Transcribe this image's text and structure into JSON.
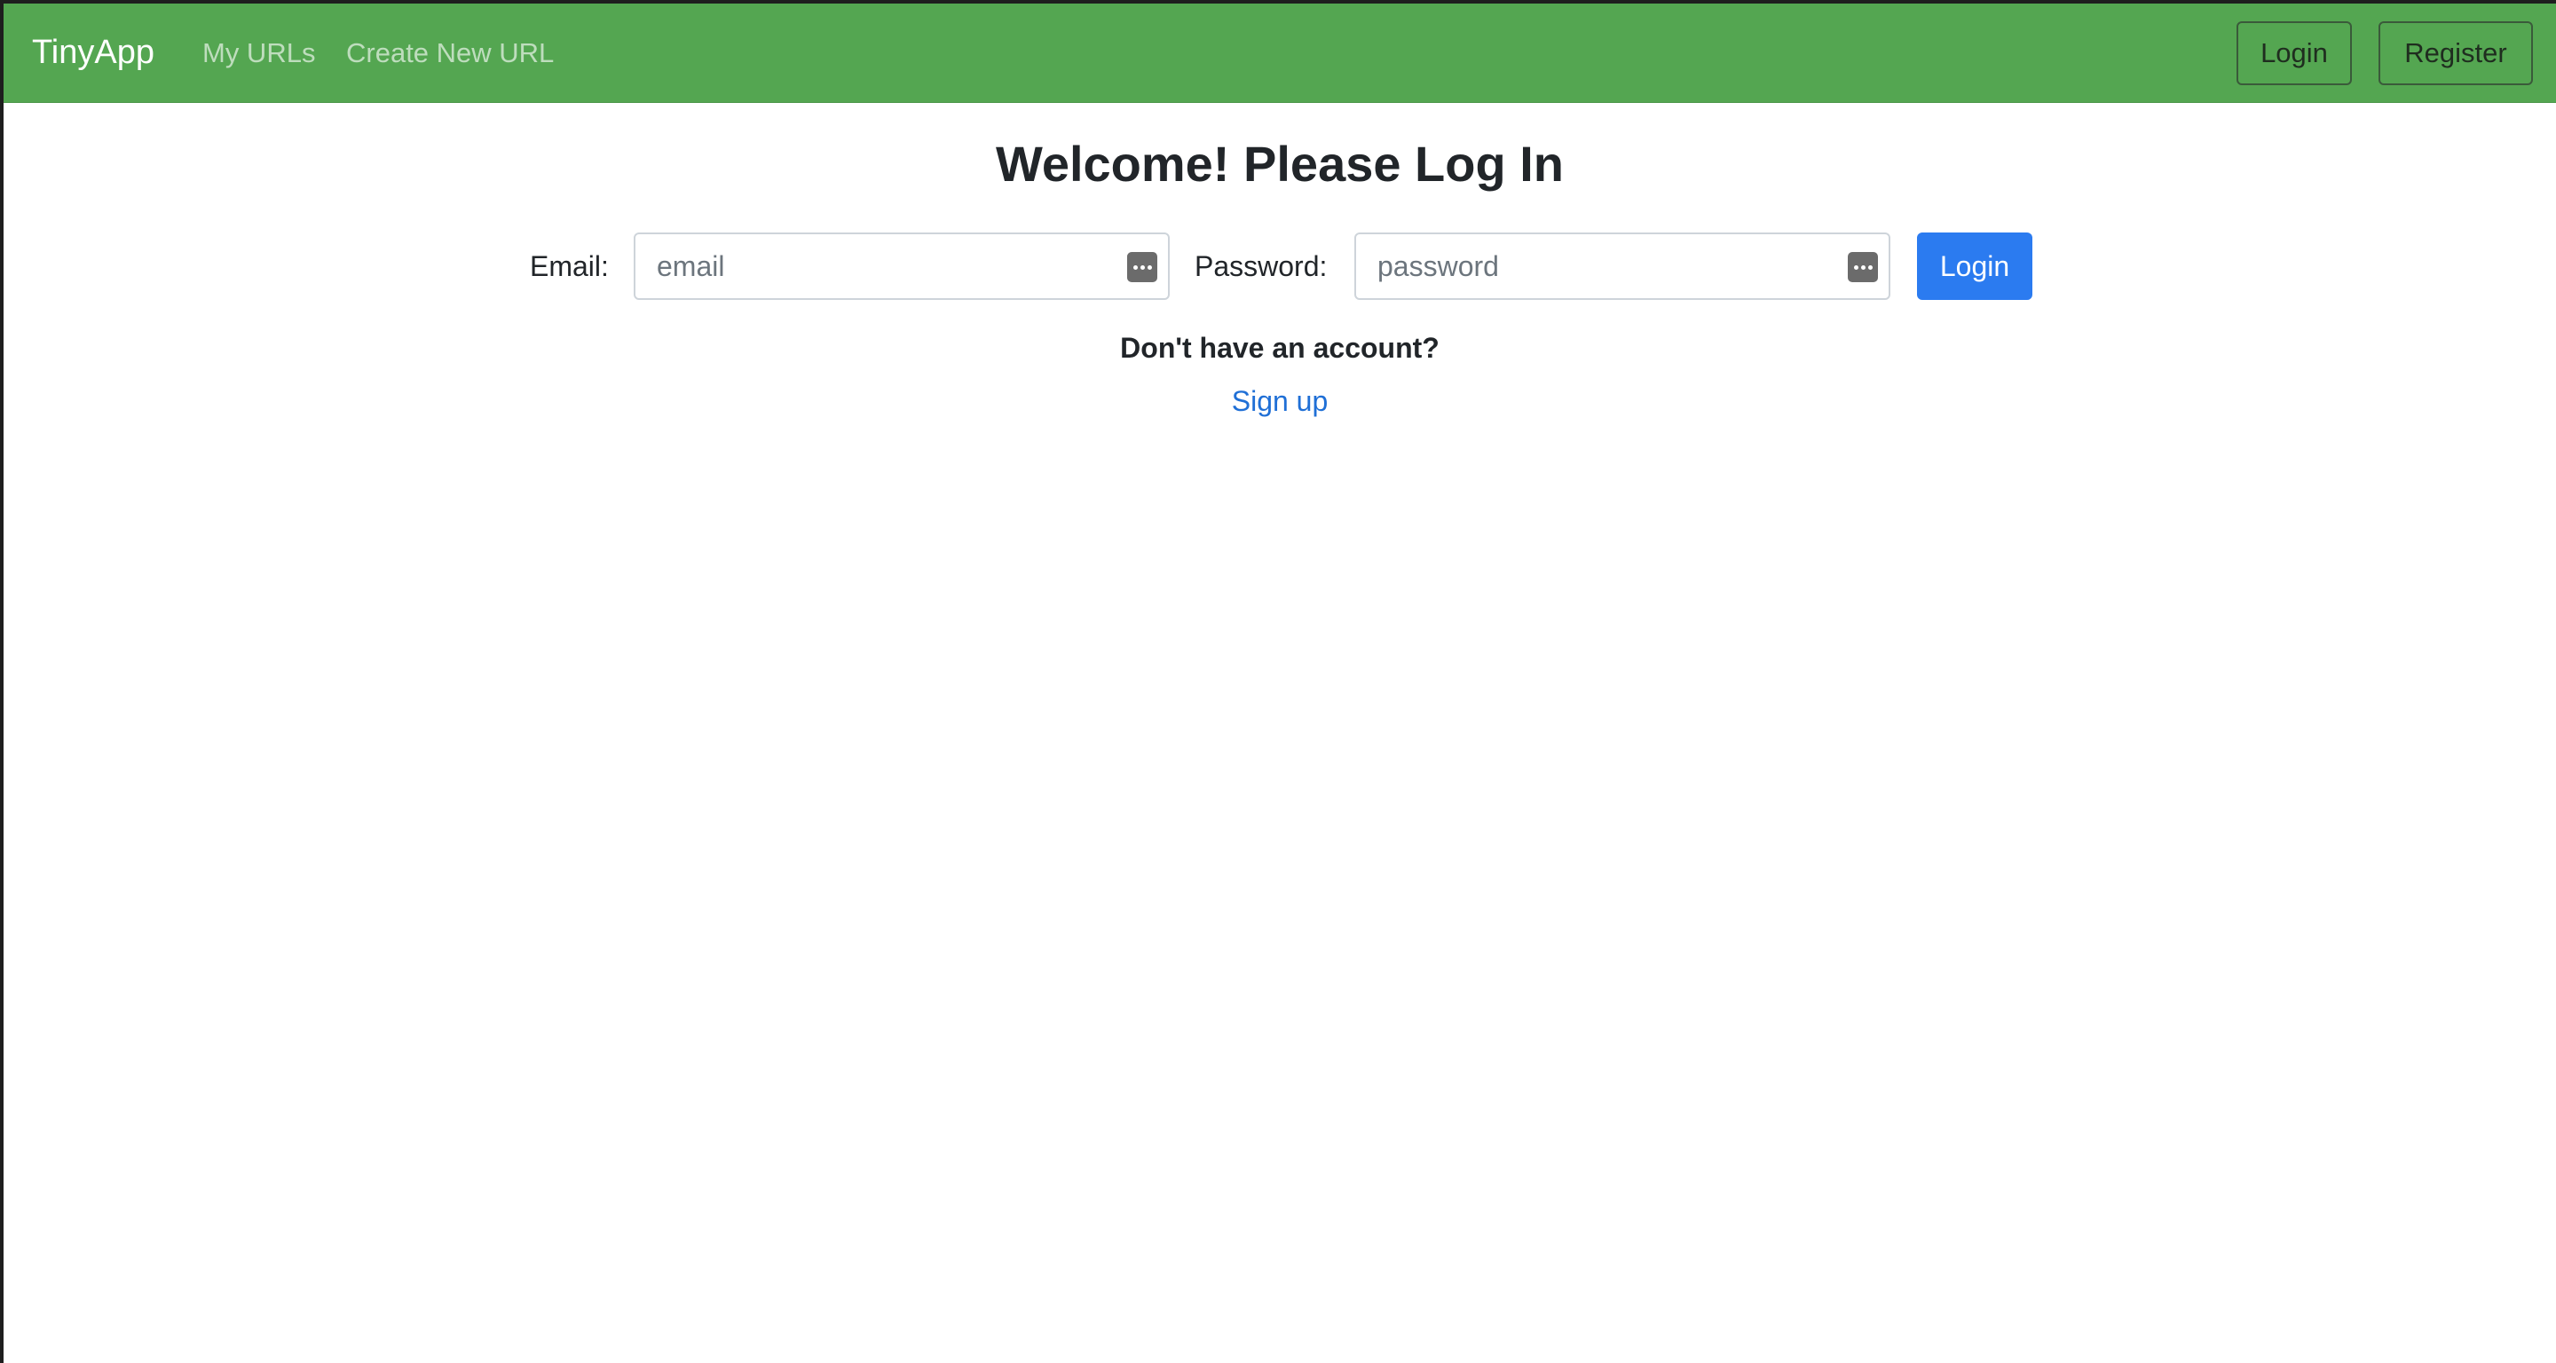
{
  "navbar": {
    "brand": "TinyApp",
    "links": [
      "My URLs",
      "Create New URL"
    ],
    "login_label": "Login",
    "register_label": "Register",
    "background_color": "#54a651"
  },
  "main": {
    "title": "Welcome! Please Log In",
    "email": {
      "label": "Email:",
      "placeholder": "email",
      "value": ""
    },
    "password": {
      "label": "Password:",
      "placeholder": "password",
      "value": ""
    },
    "submit_label": "Login",
    "signup_prompt": "Don't have an account?",
    "signup_link": "Sign up",
    "accent_color": "#2b7bf0"
  }
}
